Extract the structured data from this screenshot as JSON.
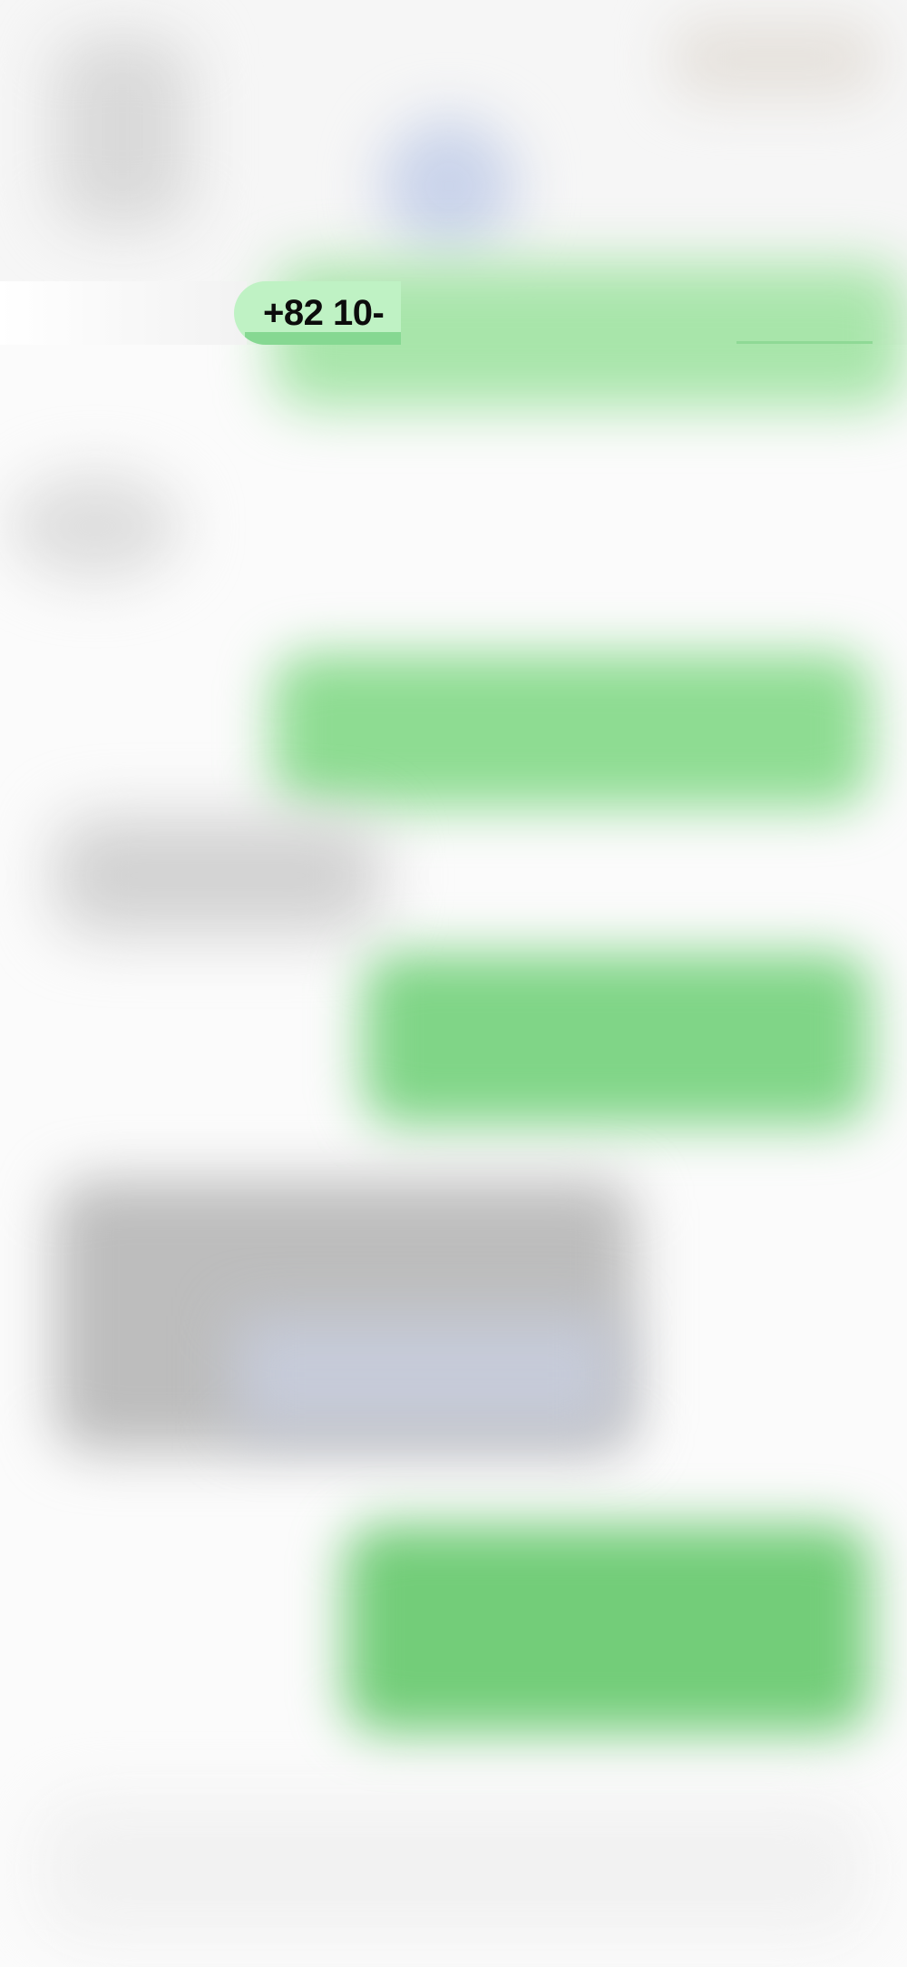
{
  "header": {
    "contact_number": "+82 10-"
  },
  "colors": {
    "outgoing_bubble": "#86dd8d",
    "incoming_bubble": "#c4c4c4",
    "number_pill": "#bff2c4",
    "background": "#fbfbfb"
  }
}
